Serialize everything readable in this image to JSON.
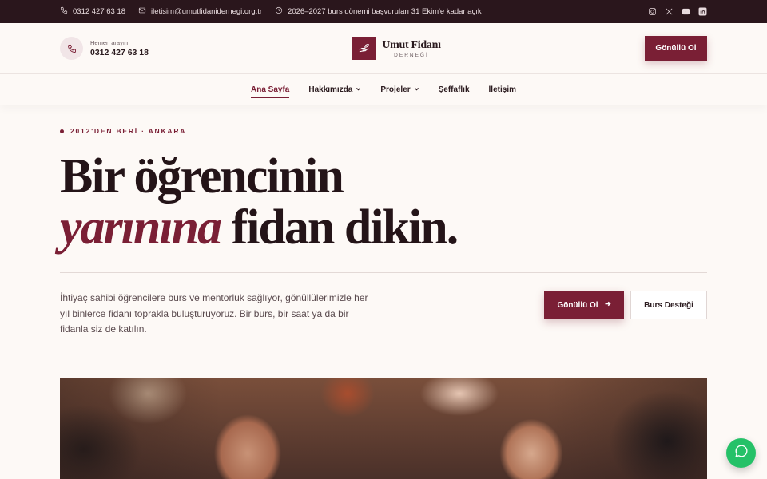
{
  "topbar": {
    "phone": "0312 427 63 18",
    "email": "iletisim@umutfidanidernegi.org.tr",
    "notice": "2026–2027 burs dönemi başvuruları 31 Ekim'e kadar açık",
    "socials": [
      "instagram-icon",
      "x-icon",
      "youtube-icon",
      "linkedin-icon"
    ]
  },
  "header": {
    "call_caption": "Hemen arayın",
    "call_number": "0312 427 63 18",
    "logo_name": "Umut Fidanı",
    "logo_sub": "DERNEĞİ",
    "cta_label": "Gönüllü Ol"
  },
  "nav": {
    "items": [
      {
        "label": "Ana Sayfa",
        "active": true
      },
      {
        "label": "Hakkımızda",
        "dropdown": true
      },
      {
        "label": "Projeler",
        "dropdown": true
      },
      {
        "label": "Şeffaflık"
      },
      {
        "label": "İletişim"
      }
    ]
  },
  "hero": {
    "eyebrow": "2012'DEN BERİ · ANKARA",
    "headline_line1": "Bir öğrencinin",
    "headline_accent": "yarınına",
    "headline_rest": "fidan dikin.",
    "description": "İhtiyaç sahibi öğrencilere burs ve mentorluk sağlıyor, gönüllülerimizle her yıl binlerce fidanı toprakla buluşturuyoruz. Bir burs, bir saat ya da bir fidanla siz de katılın.",
    "primary_cta": "Gönüllü Ol",
    "secondary_cta": "Burs Desteği"
  },
  "colors": {
    "brand": "#7a1f35",
    "topbar_bg": "#2a161c",
    "page_bg": "#fdf9f6",
    "chat": "#25c168"
  }
}
